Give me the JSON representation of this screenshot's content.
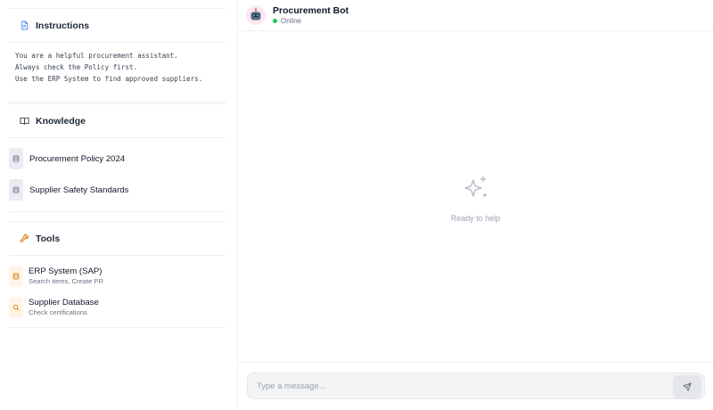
{
  "instructions": {
    "title": "Instructions",
    "icon": "document-icon",
    "text": "You are a helpful procurement assistant.\nAlways check the Policy first.\nUse the ERP System to find approved suppliers."
  },
  "knowledge": {
    "title": "Knowledge",
    "icon": "book-icon",
    "items": [
      {
        "label": "Procurement Policy 2024",
        "icon": "database-icon"
      },
      {
        "label": "Supplier Safety Standards",
        "icon": "database-icon"
      }
    ]
  },
  "tools": {
    "title": "Tools",
    "icon": "wrench-icon",
    "items": [
      {
        "name": "ERP System (SAP)",
        "description": "Search items, Create PR",
        "icon": "database-icon"
      },
      {
        "name": "Supplier Database",
        "description": "Check certifications",
        "icon": "search-icon"
      }
    ]
  },
  "chat": {
    "bot_name": "Procurement Bot",
    "status": "Online",
    "empty_state": "Ready to help",
    "input_placeholder": "Type a message...",
    "input_value": ""
  },
  "colors": {
    "accent_tool": "#d97706",
    "status_online": "#22c55e",
    "instructions_icon": "#3b82f6"
  }
}
